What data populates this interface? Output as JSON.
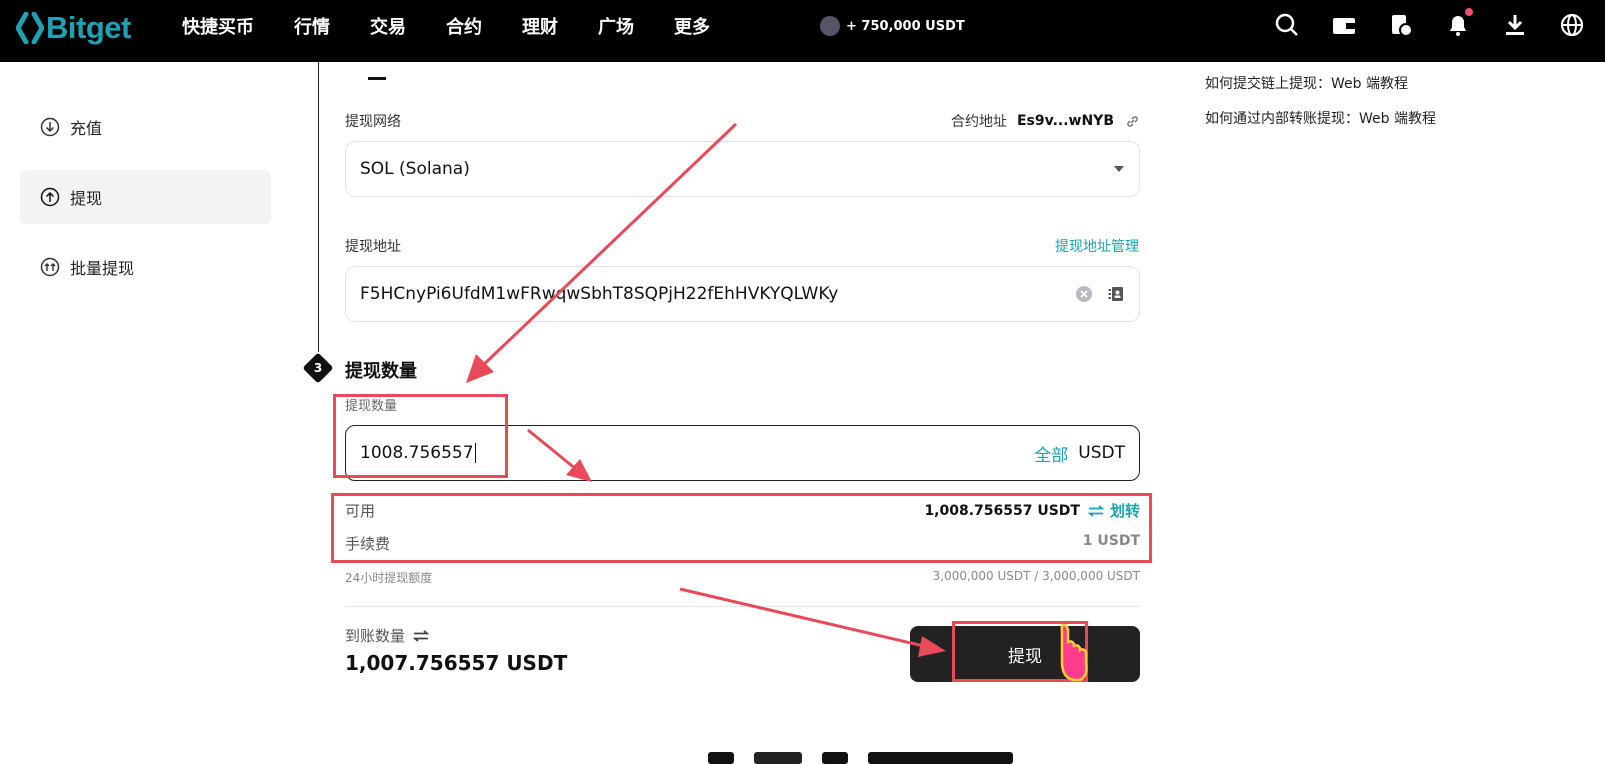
{
  "brand": {
    "name": "Bitget",
    "accent": "#1da2b4"
  },
  "nav": [
    "快捷买币",
    "行情",
    "交易",
    "合约",
    "理财",
    "广场",
    "更多"
  ],
  "promo": "+ 750,000 USDT",
  "top_icons": [
    "search-icon",
    "wallet-icon",
    "orders-icon",
    "bell-icon",
    "download-icon",
    "globe-icon"
  ],
  "sidebar": [
    {
      "label": "充值",
      "icon": "deposit-icon"
    },
    {
      "label": "提现",
      "icon": "withdraw-icon",
      "active": true
    },
    {
      "label": "批量提现",
      "icon": "batch-withdraw-icon"
    }
  ],
  "network": {
    "label": "提现网络",
    "contract_label": "合约地址",
    "contract_value": "Es9v...wNYB",
    "value": "SOL (Solana)"
  },
  "address": {
    "label": "提现地址",
    "manage_link": "提现地址管理",
    "value": "F5HCnyPi6UfdM1wFRwqwSbhT8SQPjH22fEhHVKYQLWKy"
  },
  "step3": {
    "number": "3",
    "title": "提现数量"
  },
  "amount": {
    "label": "提现数量",
    "value": "1008.756557",
    "all_link": "全部",
    "unit": "USDT"
  },
  "available": {
    "label": "可用",
    "value": "1,008.756557 USDT",
    "transfer_link": "划转"
  },
  "fee": {
    "label": "手续费",
    "value": "1 USDT"
  },
  "limit": {
    "label": "24小时提现额度",
    "value": "3,000,000 USDT / 3,000,000 USDT"
  },
  "receive": {
    "label": "到账数量",
    "value": "1,007.756557 USDT"
  },
  "submit_label": "提现",
  "help": [
    "如何提交链上提现：Web 端教程",
    "如何通过内部转账提现：Web 端教程"
  ],
  "annotation_color": "#e84a5a"
}
